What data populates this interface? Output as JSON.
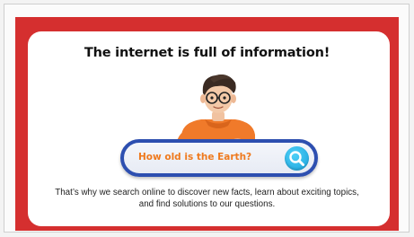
{
  "card": {
    "title": "The internet is full of information!",
    "search_text": "How old is the Earth?",
    "caption": "That’s why we search online to discover new facts, learn about exciting topics, and find solutions to our questions."
  },
  "icons": [
    "magnifier-icon",
    "cartoon-boy-illustration"
  ],
  "colors": {
    "frame_red": "#d52f2f",
    "search_border": "#2d4fb0",
    "search_text": "#ef7a1e",
    "search_button": "#1aa2dc",
    "shirt_orange": "#f07a2a"
  }
}
